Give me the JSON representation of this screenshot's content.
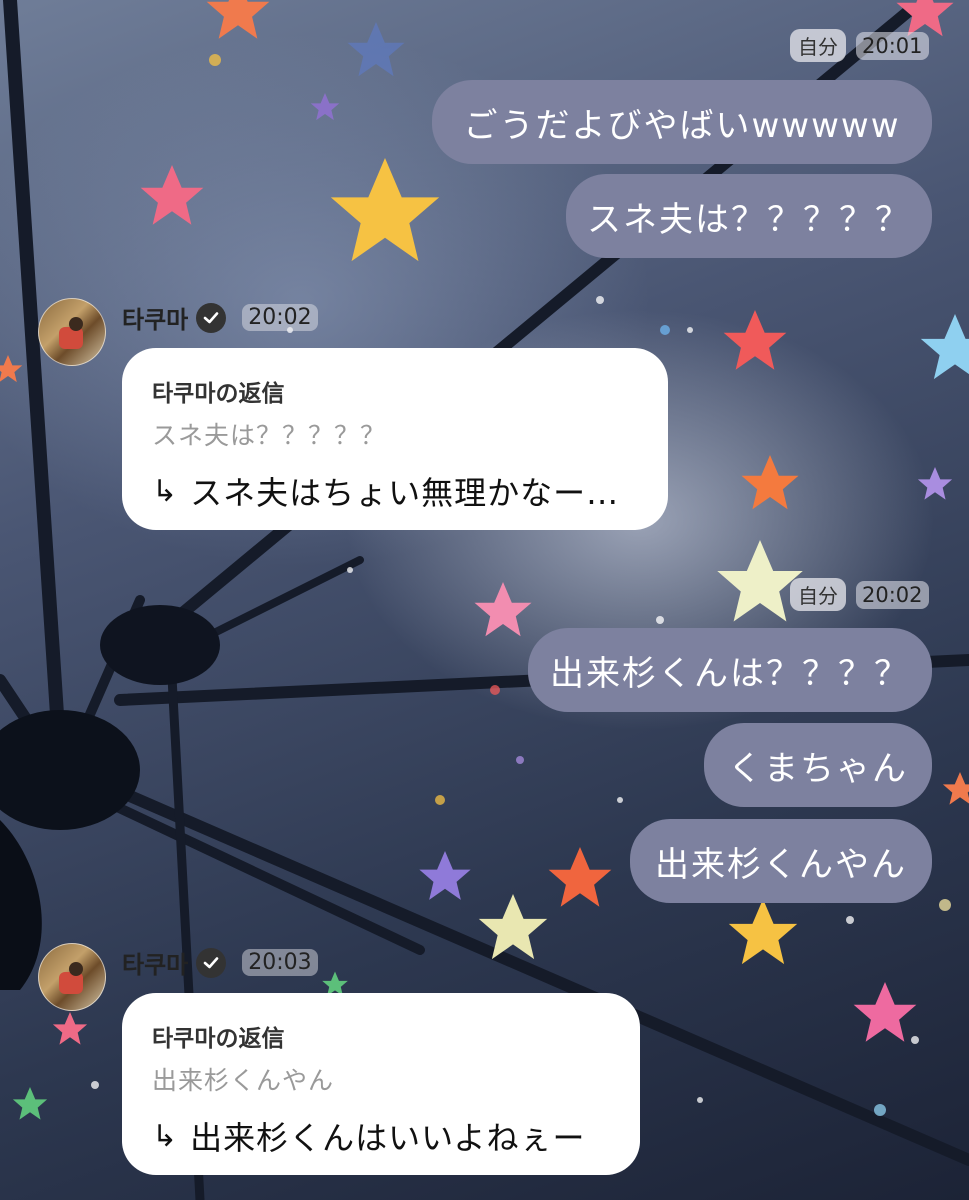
{
  "colors": {
    "my_bubble": "#7d819f",
    "reply_card": "#ffffff",
    "verified_badge": "#333333"
  },
  "messages": {
    "group1": {
      "sender_label": "自分",
      "time": "20:01",
      "bubbles": [
        "ごうだよびやばいwwwww",
        "スネ夫は？？？？？"
      ]
    },
    "reply1": {
      "sender": "타쿠마",
      "time": "20:02",
      "reply_title": "타쿠마の返信",
      "quoted": "スネ夫は？？？？？",
      "text": "スネ夫はちょい無理かなー…"
    },
    "group2": {
      "sender_label": "自分",
      "time": "20:02",
      "bubbles": [
        "出来杉くんは？？？？",
        "くまちゃん",
        "出来杉くんやん"
      ]
    },
    "reply2": {
      "sender": "타쿠마",
      "time": "20:03",
      "reply_title": "타쿠마の返信",
      "quoted": "出来杉くんやん",
      "text": "出来杉くんはいいよねぇー"
    }
  },
  "icons": {
    "verified": "verified-check-icon",
    "reply_arrow": "reply-arrow-icon"
  }
}
